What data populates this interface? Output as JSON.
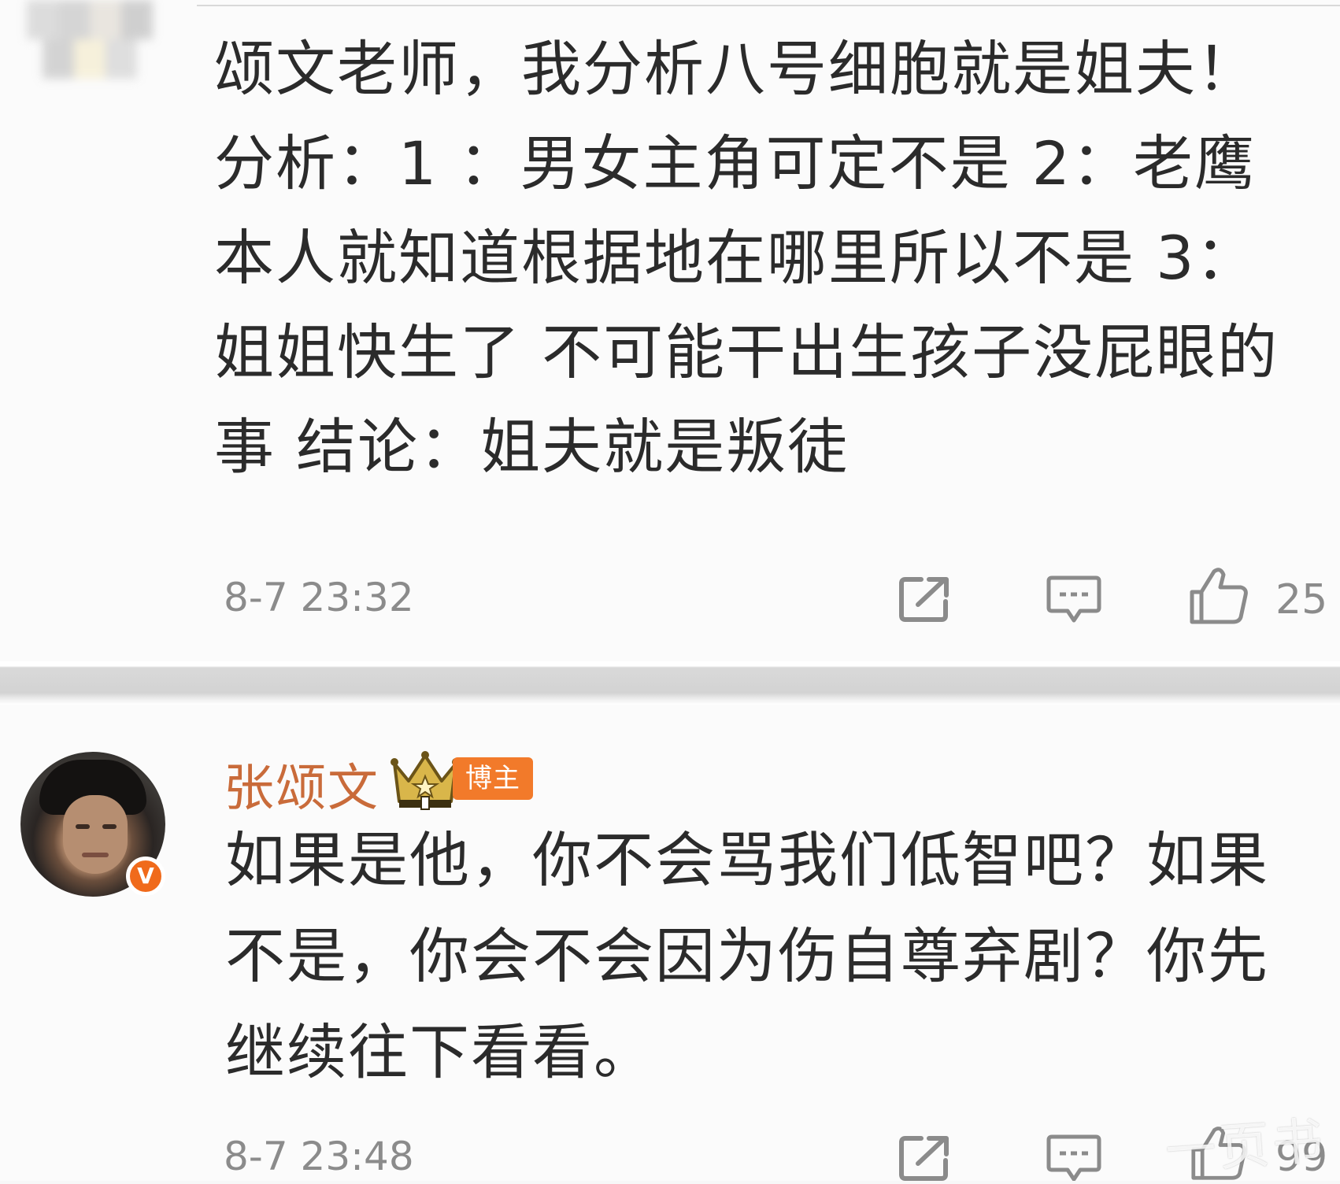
{
  "comments": [
    {
      "text": "颂文老师，我分析八号细胞就是姐夫！分析：1 ：男女主角可定不是 2：老鹰本人就知道根据地在哪里所以不是 3：姐姐快生了 不可能干出生孩子没屁眼的事 结论：姐夫就是叛徒",
      "time": "8-7 23:32",
      "likes": "25",
      "icons": [
        "share-icon",
        "comment-icon",
        "like-icon"
      ]
    },
    {
      "username": "张颂文",
      "badge": "博主",
      "verified_badge": "V",
      "text": "如果是他，你不会骂我们低智吧？如果不是，你会不会因为伤自尊弃剧？你先继续往下看看。",
      "time": "8-7 23:48",
      "likes": "99",
      "icons": [
        "share-icon",
        "comment-icon",
        "like-icon"
      ]
    }
  ],
  "watermark": "一页书",
  "colors": {
    "username": "#c96b3a",
    "badge_bg": "#f27a2a",
    "verified_bg": "#f06a1b",
    "meta_gray": "#8b8b8b",
    "separator": "#d3d3d3"
  }
}
